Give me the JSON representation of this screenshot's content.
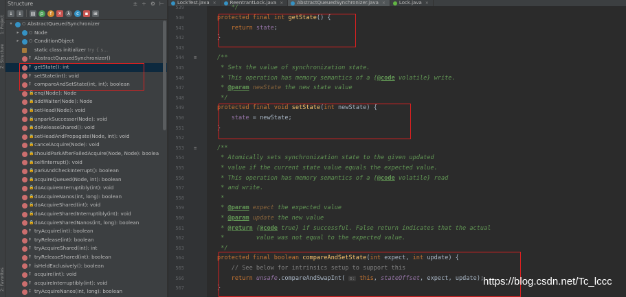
{
  "side_labels": {
    "top": "1: Project",
    "middle": "Z: Structure",
    "bottom": "2: Favorites"
  },
  "structure": {
    "title": "Structure",
    "tree": [
      {
        "label": "AbstractQueuedSynchronizer",
        "hint": "",
        "icon": "class",
        "expand": "▾",
        "indent": 0,
        "selected": false
      },
      {
        "label": "Node",
        "hint": "",
        "icon": "class",
        "expand": "▸",
        "indent": 1,
        "selected": false
      },
      {
        "label": "ConditionObject",
        "hint": "",
        "icon": "class",
        "expand": "▸",
        "indent": 1,
        "selected": false
      },
      {
        "label": "static class initializer",
        "hint": "  try {        s...",
        "icon": "static",
        "expand": "",
        "indent": 1,
        "selected": false
      },
      {
        "label": "AbstractQueuedSynchronizer()",
        "hint": "",
        "icon": "method",
        "expand": "",
        "indent": 1,
        "selected": false
      },
      {
        "label": "getState(): int",
        "hint": "",
        "icon": "method",
        "expand": "",
        "indent": 1,
        "selected": true
      },
      {
        "label": "setState(int): void",
        "hint": "",
        "icon": "method",
        "expand": "",
        "indent": 1,
        "selected": false
      },
      {
        "label": "compareAndSetState(int, int): boolean",
        "hint": "",
        "icon": "method",
        "expand": "",
        "indent": 1,
        "selected": false
      },
      {
        "label": "enq(Node): Node",
        "hint": "",
        "icon": "method",
        "expand": "",
        "indent": 1,
        "selected": false
      },
      {
        "label": "addWaiter(Node): Node",
        "hint": "",
        "icon": "method",
        "expand": "",
        "indent": 1,
        "selected": false
      },
      {
        "label": "setHead(Node): void",
        "hint": "",
        "icon": "method",
        "expand": "",
        "indent": 1,
        "selected": false
      },
      {
        "label": "unparkSuccessor(Node): void",
        "hint": "",
        "icon": "method",
        "expand": "",
        "indent": 1,
        "selected": false
      },
      {
        "label": "doReleaseShared(): void",
        "hint": "",
        "icon": "method",
        "expand": "",
        "indent": 1,
        "selected": false
      },
      {
        "label": "setHeadAndPropagate(Node, int): void",
        "hint": "",
        "icon": "method",
        "expand": "",
        "indent": 1,
        "selected": false
      },
      {
        "label": "cancelAcquire(Node): void",
        "hint": "",
        "icon": "method",
        "expand": "",
        "indent": 1,
        "selected": false
      },
      {
        "label": "shouldParkAfterFailedAcquire(Node, Node): boolea",
        "hint": "",
        "icon": "method",
        "expand": "",
        "indent": 1,
        "selected": false
      },
      {
        "label": "selfInterrupt(): void",
        "hint": "",
        "icon": "method",
        "expand": "",
        "indent": 1,
        "selected": false
      },
      {
        "label": "parkAndCheckInterrupt(): boolean",
        "hint": "",
        "icon": "method",
        "expand": "",
        "indent": 1,
        "selected": false
      },
      {
        "label": "acquireQueued(Node, int): boolean",
        "hint": "",
        "icon": "method",
        "expand": "",
        "indent": 1,
        "selected": false
      },
      {
        "label": "doAcquireInterruptibly(int): void",
        "hint": "",
        "icon": "method",
        "expand": "",
        "indent": 1,
        "selected": false
      },
      {
        "label": "doAcquireNanos(int, long): boolean",
        "hint": "",
        "icon": "method",
        "expand": "",
        "indent": 1,
        "selected": false
      },
      {
        "label": "doAcquireShared(int): void",
        "hint": "",
        "icon": "method",
        "expand": "",
        "indent": 1,
        "selected": false
      },
      {
        "label": "doAcquireSharedInterruptibly(int): void",
        "hint": "",
        "icon": "method",
        "expand": "",
        "indent": 1,
        "selected": false
      },
      {
        "label": "doAcquireSharedNanos(int, long): boolean",
        "hint": "",
        "icon": "method",
        "expand": "",
        "indent": 1,
        "selected": false
      },
      {
        "label": "tryAcquire(int): boolean",
        "hint": "",
        "icon": "method",
        "expand": "",
        "indent": 1,
        "selected": false
      },
      {
        "label": "tryRelease(int): boolean",
        "hint": "",
        "icon": "method",
        "expand": "",
        "indent": 1,
        "selected": false
      },
      {
        "label": "tryAcquireShared(int): int",
        "hint": "",
        "icon": "method",
        "expand": "",
        "indent": 1,
        "selected": false
      },
      {
        "label": "tryReleaseShared(int): boolean",
        "hint": "",
        "icon": "method",
        "expand": "",
        "indent": 1,
        "selected": false
      },
      {
        "label": "isHeldExclusively(): boolean",
        "hint": "",
        "icon": "method",
        "expand": "",
        "indent": 1,
        "selected": false
      },
      {
        "label": "acquire(int): void",
        "hint": "",
        "icon": "method",
        "expand": "",
        "indent": 1,
        "selected": false
      },
      {
        "label": "acquireInterruptibly(int): void",
        "hint": "",
        "icon": "method",
        "expand": "",
        "indent": 1,
        "selected": false
      },
      {
        "label": "tryAcquireNanos(int, long): boolean",
        "hint": "",
        "icon": "method",
        "expand": "",
        "indent": 1,
        "selected": false
      }
    ]
  },
  "tabs": [
    {
      "label": "LockTest.java",
      "active": false
    },
    {
      "label": "ReentrantLock.java",
      "active": false
    },
    {
      "label": "AbstractQueuedSynchronizer.java",
      "active": true
    },
    {
      "label": "Lock.java",
      "active": false
    }
  ],
  "editor": {
    "lines": [
      {
        "n": "539",
        "gutter": "",
        "parts": [
          [
            "cmt",
            "    */"
          ]
        ]
      },
      {
        "n": "540",
        "gutter": "",
        "parts": [
          [
            "kw",
            "protected final int "
          ],
          [
            "fn",
            "getState"
          ],
          [
            "",
            "() {"
          ]
        ]
      },
      {
        "n": "541",
        "gutter": "",
        "parts": [
          [
            "",
            "    "
          ],
          [
            "kw",
            "return "
          ],
          [
            "fld",
            "state"
          ],
          [
            "",
            ";"
          ]
        ]
      },
      {
        "n": "542",
        "gutter": "",
        "parts": [
          [
            "",
            "}"
          ]
        ]
      },
      {
        "n": "543",
        "gutter": "",
        "parts": []
      },
      {
        "n": "544",
        "gutter": "≡",
        "parts": [
          [
            "cmt",
            "/**"
          ]
        ]
      },
      {
        "n": "545",
        "gutter": "",
        "parts": [
          [
            "cmt",
            " * Sets the value of synchronization state."
          ]
        ]
      },
      {
        "n": "546",
        "gutter": "",
        "parts": [
          [
            "cmt",
            " * This operation has memory semantics of a {"
          ],
          [
            "tag",
            "@code"
          ],
          [
            "cmt",
            " volatile} write."
          ]
        ]
      },
      {
        "n": "547",
        "gutter": "",
        "parts": [
          [
            "cmt",
            " * "
          ],
          [
            "tag",
            "@param"
          ],
          [
            "prm",
            " newState"
          ],
          [
            "cmt",
            " the new state value"
          ]
        ]
      },
      {
        "n": "548",
        "gutter": "",
        "parts": [
          [
            "cmt",
            " */"
          ]
        ]
      },
      {
        "n": "549",
        "gutter": "",
        "parts": [
          [
            "kw",
            "protected final void "
          ],
          [
            "fn",
            "setState"
          ],
          [
            "",
            "("
          ],
          [
            "kw",
            "int "
          ],
          [
            "",
            "newState) {"
          ]
        ]
      },
      {
        "n": "550",
        "gutter": "",
        "parts": [
          [
            "",
            "    "
          ],
          [
            "fld",
            "state"
          ],
          [
            "",
            " = newState;"
          ]
        ]
      },
      {
        "n": "551",
        "gutter": "",
        "parts": [
          [
            "",
            "}"
          ]
        ]
      },
      {
        "n": "552",
        "gutter": "",
        "parts": []
      },
      {
        "n": "553",
        "gutter": "≡",
        "parts": [
          [
            "cmt",
            "/**"
          ]
        ]
      },
      {
        "n": "554",
        "gutter": "",
        "parts": [
          [
            "cmt",
            " * Atomically sets synchronization state to the given updated"
          ]
        ]
      },
      {
        "n": "555",
        "gutter": "",
        "parts": [
          [
            "cmt",
            " * value if the current state value equals the expected value."
          ]
        ]
      },
      {
        "n": "556",
        "gutter": "",
        "parts": [
          [
            "cmt",
            " * This operation has memory semantics of a {"
          ],
          [
            "tag",
            "@code"
          ],
          [
            "cmt",
            " volatile} read"
          ]
        ]
      },
      {
        "n": "557",
        "gutter": "",
        "parts": [
          [
            "cmt",
            " * and write."
          ]
        ]
      },
      {
        "n": "558",
        "gutter": "",
        "parts": [
          [
            "cmt",
            " *"
          ]
        ]
      },
      {
        "n": "559",
        "gutter": "",
        "parts": [
          [
            "cmt",
            " * "
          ],
          [
            "tag",
            "@param"
          ],
          [
            "prm",
            " expect"
          ],
          [
            "cmt",
            " the expected value"
          ]
        ]
      },
      {
        "n": "560",
        "gutter": "",
        "parts": [
          [
            "cmt",
            " * "
          ],
          [
            "tag",
            "@param"
          ],
          [
            "prm",
            " update"
          ],
          [
            "cmt",
            " the new value"
          ]
        ]
      },
      {
        "n": "561",
        "gutter": "",
        "parts": [
          [
            "cmt",
            " * "
          ],
          [
            "tag",
            "@return"
          ],
          [
            "cmt",
            " {"
          ],
          [
            "tag",
            "@code"
          ],
          [
            "cmt",
            " true} if successful. False return indicates that the actual"
          ]
        ]
      },
      {
        "n": "562",
        "gutter": "",
        "parts": [
          [
            "cmt",
            " *         value was not equal to the expected value."
          ]
        ]
      },
      {
        "n": "563",
        "gutter": "",
        "parts": [
          [
            "cmt",
            " */"
          ]
        ]
      },
      {
        "n": "564",
        "gutter": "",
        "parts": [
          [
            "kw",
            "protected final boolean "
          ],
          [
            "fn",
            "compareAndSetState"
          ],
          [
            "",
            "("
          ],
          [
            "kw",
            "int "
          ],
          [
            "",
            "expect, "
          ],
          [
            "kw",
            "int "
          ],
          [
            "",
            "update) {"
          ]
        ]
      },
      {
        "n": "565",
        "gutter": "",
        "parts": [
          [
            "cmtg",
            "    // See below for intrinsics setup to support this"
          ]
        ]
      },
      {
        "n": "566",
        "gutter": "",
        "parts": [
          [
            "",
            "    "
          ],
          [
            "kw",
            "return "
          ],
          [
            "fld itl",
            "unsafe"
          ],
          [
            "",
            ".compareAndSwapInt( "
          ],
          [
            "hint2",
            "o:"
          ],
          [
            "kw",
            " this"
          ],
          [
            "",
            ", "
          ],
          [
            "fld itl",
            "stateOffset"
          ],
          [
            "",
            ", expect, update);"
          ]
        ]
      },
      {
        "n": "567",
        "gutter": "",
        "parts": [
          [
            "",
            "}"
          ]
        ]
      }
    ]
  },
  "watermark": "https://blog.csdn.net/Tc_lccc",
  "colors": {
    "highlight_box": "#e02020",
    "selection": "#0d293e",
    "keyword": "#cc7832",
    "method": "#ffc66d",
    "field": "#9876aa",
    "doc_comment": "#629755"
  }
}
